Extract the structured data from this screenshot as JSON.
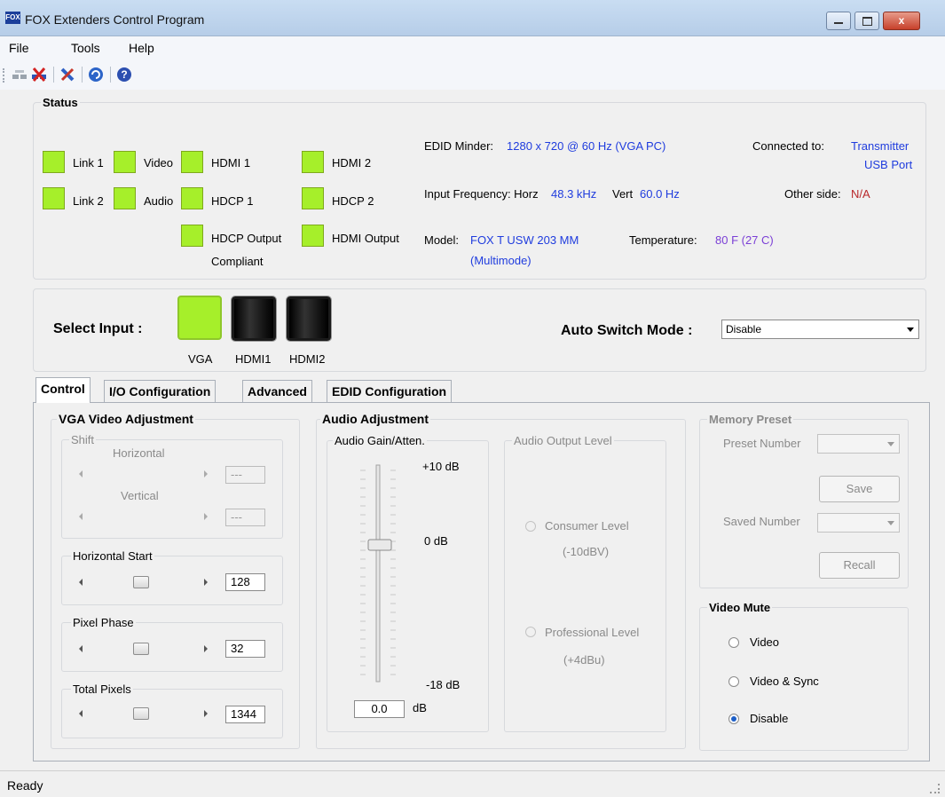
{
  "window": {
    "title": "FOX Extenders Control Program",
    "icon_text": "FOX",
    "close_symbol": "x"
  },
  "menu": {
    "file": "File",
    "tools": "Tools",
    "help": "Help"
  },
  "toolbar": {
    "icons": [
      "connect-icon",
      "disconnect-icon",
      "tools-icon",
      "refresh-icon",
      "help-icon"
    ]
  },
  "status": {
    "title": "Status",
    "link1": "Link 1",
    "link2": "Link 2",
    "video": "Video",
    "audio": "Audio",
    "hdmi1": "HDMI 1",
    "hdmi2": "HDMI 2",
    "hdcp1": "HDCP 1",
    "hdcp2": "HDCP 2",
    "hdcp_output": "HDCP Output",
    "compliant": "Compliant",
    "hdmi_output": "HDMI Output",
    "edid_minder_label": "EDID Minder:",
    "edid_minder_value": "1280 x 720 @ 60 Hz (VGA PC)",
    "input_freq_label": "Input Frequency: Horz",
    "horz_value": "48.3 kHz",
    "vert_label": "Vert",
    "vert_value": "60.0 Hz",
    "model_label": "Model:",
    "model_value": "FOX T USW 203 MM",
    "model_value2": "(Multimode)",
    "temp_label": "Temperature:",
    "temp_value": "80 F (27 C)",
    "connected_label": "Connected to:",
    "connected_value1": "Transmitter",
    "connected_value2": "USB Port",
    "other_side_label": "Other side:",
    "other_side_value": "N/A",
    "led_color": "#a6ef2a"
  },
  "input": {
    "select_label": "Select Input :",
    "vga": "VGA",
    "hdmi1": "HDMI1",
    "hdmi2": "HDMI2",
    "auto_switch_label": "Auto Switch Mode :",
    "auto_switch_value": "Disable"
  },
  "tabs": {
    "control": "Control",
    "io": "I/O Configuration",
    "advanced": "Advanced",
    "edid": "EDID Configuration"
  },
  "vga": {
    "title": "VGA Video Adjustment",
    "shift_label": "Shift",
    "horizontal": "Horizontal",
    "vertical": "Vertical",
    "horiz_shift_value": "---",
    "vert_shift_value": "---",
    "hstart_label": "Horizontal Start",
    "hstart_value": "128",
    "phase_label": "Pixel Phase",
    "phase_value": "32",
    "total_label": "Total Pixels",
    "total_value": "1344"
  },
  "audio": {
    "title": "Audio Adjustment",
    "gain_label": "Audio Gain/Atten.",
    "max_label": "+10 dB",
    "mid_label": "0 dB",
    "min_label": "-18 dB",
    "gain_value": "0.0",
    "gain_unit": "dB",
    "output_label": "Audio Output Level",
    "consumer": "Consumer Level",
    "consumer_sub": "(-10dBV)",
    "professional": "Professional Level",
    "professional_sub": "(+4dBu)"
  },
  "memory": {
    "title": "Memory Preset",
    "preset_label": "Preset Number",
    "save": "Save",
    "saved_label": "Saved Number",
    "recall": "Recall"
  },
  "mute": {
    "title": "Video Mute",
    "video": "Video",
    "video_sync": "Video & Sync",
    "disable": "Disable",
    "selected": "Disable"
  },
  "statusbar": {
    "text": "Ready"
  }
}
